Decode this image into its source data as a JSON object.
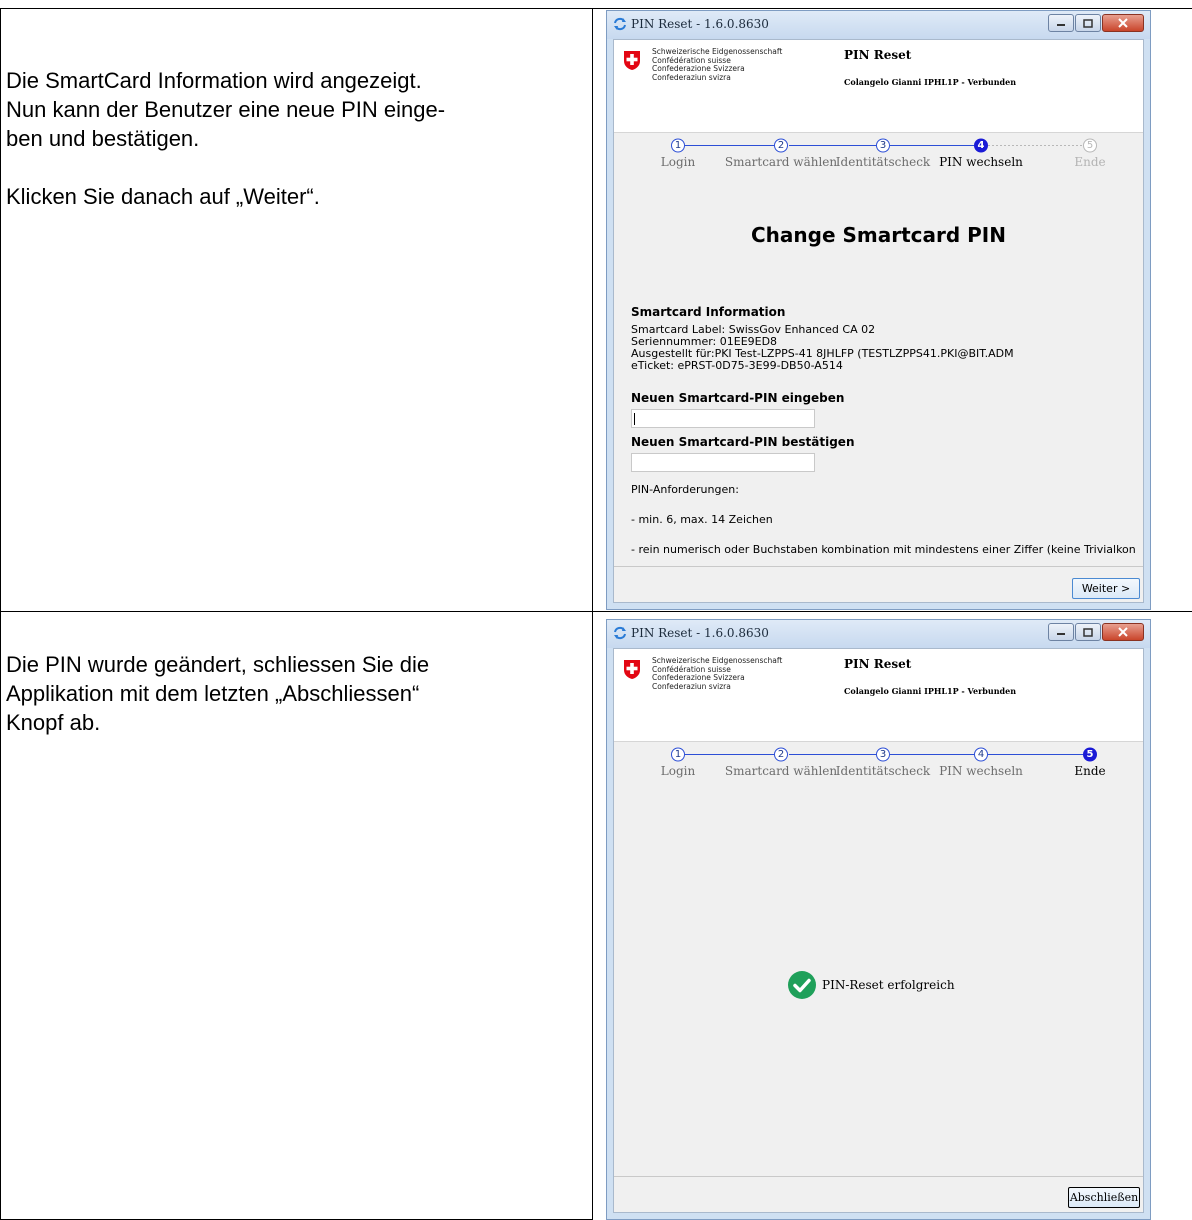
{
  "instructions": {
    "row1": {
      "line1": "Die SmartCard Information wird angezeigt.",
      "line2": "Nun kann der Benutzer eine neue PIN einge-",
      "line3": "ben und bestätigen.",
      "line4": "Klicken Sie danach auf „Weiter“."
    },
    "row2": {
      "line1": "Die PIN wurde geändert, schliessen Sie die",
      "line2": "Applikation mit dem letzten „Abschliessen“",
      "line3": "Knopf ab."
    }
  },
  "window": {
    "title": "PIN Reset - 1.6.0.8630",
    "confederation": [
      "Schweizerische Eidgenossenschaft",
      "Confédération suisse",
      "Confederazione Svizzera",
      "Confederaziun svizra"
    ],
    "app_title": "PIN Reset",
    "user_status": "Colangelo Gianni IPHL1P - Verbunden",
    "steps": [
      {
        "num": "1",
        "label": "Login"
      },
      {
        "num": "2",
        "label": "Smartcard wählen"
      },
      {
        "num": "3",
        "label": "Identitätscheck"
      },
      {
        "num": "4",
        "label": "PIN wechseln"
      },
      {
        "num": "5",
        "label": "Ende"
      }
    ]
  },
  "screen1": {
    "active_step": 4,
    "heading": "Change Smartcard PIN",
    "info_title": "Smartcard Information",
    "label_line": "Smartcard Label: SwissGov Enhanced CA 02",
    "serial_line": "Seriennummer: 01EE9ED8",
    "issued_line": "Ausgestellt für:PKI Test-LZPPS-41 8JHLFP (TESTLZPPS41.PKI@BIT.ADM",
    "ticket_line": "eTicket: ePRST-0D75-3E99-DB50-A514",
    "new_pin_label": "Neuen Smartcard-PIN eingeben",
    "new_pin_value": "",
    "confirm_pin_label": "Neuen Smartcard-PIN bestätigen",
    "confirm_pin_value": "",
    "requirements_title": "PIN-Anforderungen:",
    "requirement1": " - min. 6, max. 14 Zeichen",
    "requirement2": " - rein numerisch oder Buchstaben kombination mit mindestens einer Ziffer (keine Trivialkon",
    "next_button": "Weiter >"
  },
  "screen2": {
    "active_step": 5,
    "success_text": "PIN-Reset erfolgreich",
    "finish_button": "Abschließen"
  },
  "colors": {
    "step_active": "#1a1ad6",
    "step_line": "#2d4fd6",
    "success_green": "#1fa05a",
    "swiss_red": "#e30613"
  }
}
